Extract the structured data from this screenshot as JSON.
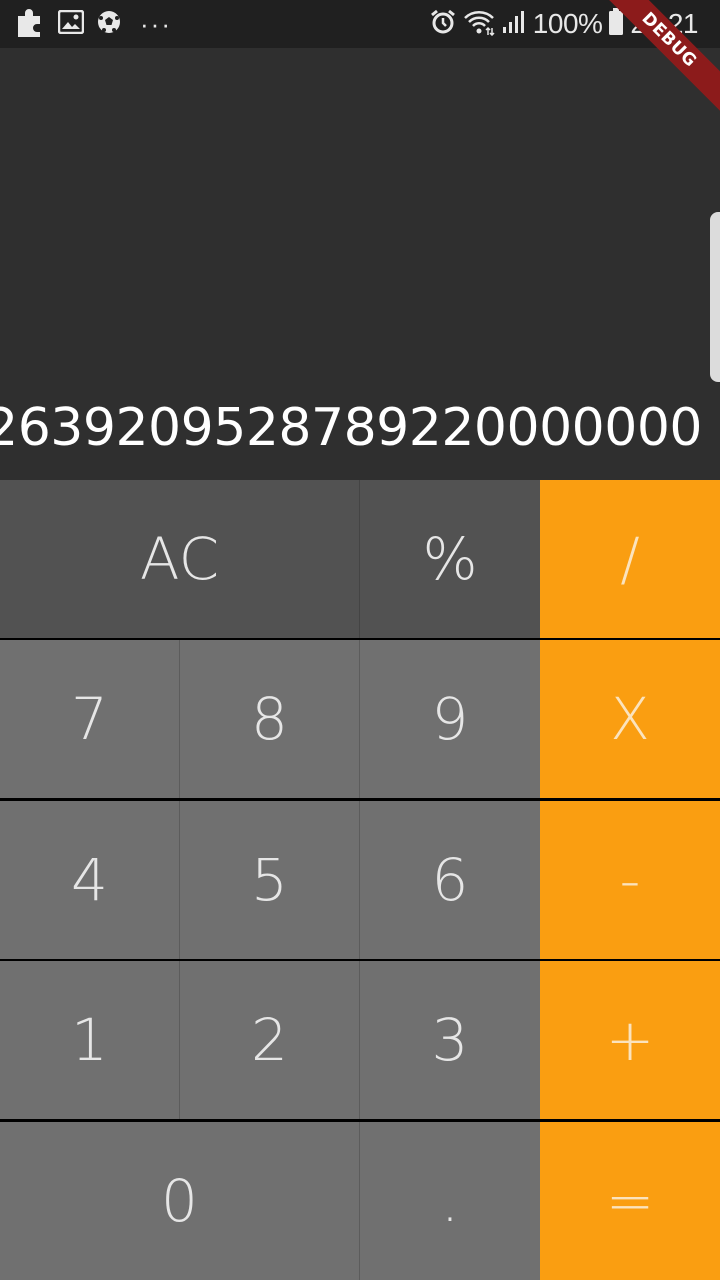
{
  "status_bar": {
    "battery": "100%",
    "time": "21:21",
    "more": "···",
    "left_icons": [
      "puzzle-icon",
      "image-icon",
      "soccer-ball-icon"
    ],
    "right_icons": [
      "alarm-icon",
      "wifi-icon",
      "signal-icon",
      "battery-icon"
    ]
  },
  "debug_banner": "DEBUG",
  "display": {
    "value": "2639209528789220000000"
  },
  "keys": {
    "ac": "AC",
    "percent": "%",
    "divide": "/",
    "seven": "7",
    "eight": "8",
    "nine": "9",
    "multiply": "X",
    "four": "4",
    "five": "5",
    "six": "6",
    "minus": "-",
    "one": "1",
    "two": "2",
    "three": "3",
    "plus": "+",
    "zero": "0",
    "dot": ".",
    "equals": "="
  },
  "colors": {
    "display_bg": "#2f2f2f",
    "function_key": "#525252",
    "number_key": "#707070",
    "operator_key": "#fa9e11",
    "debug_banner": "#8c1b1b"
  }
}
